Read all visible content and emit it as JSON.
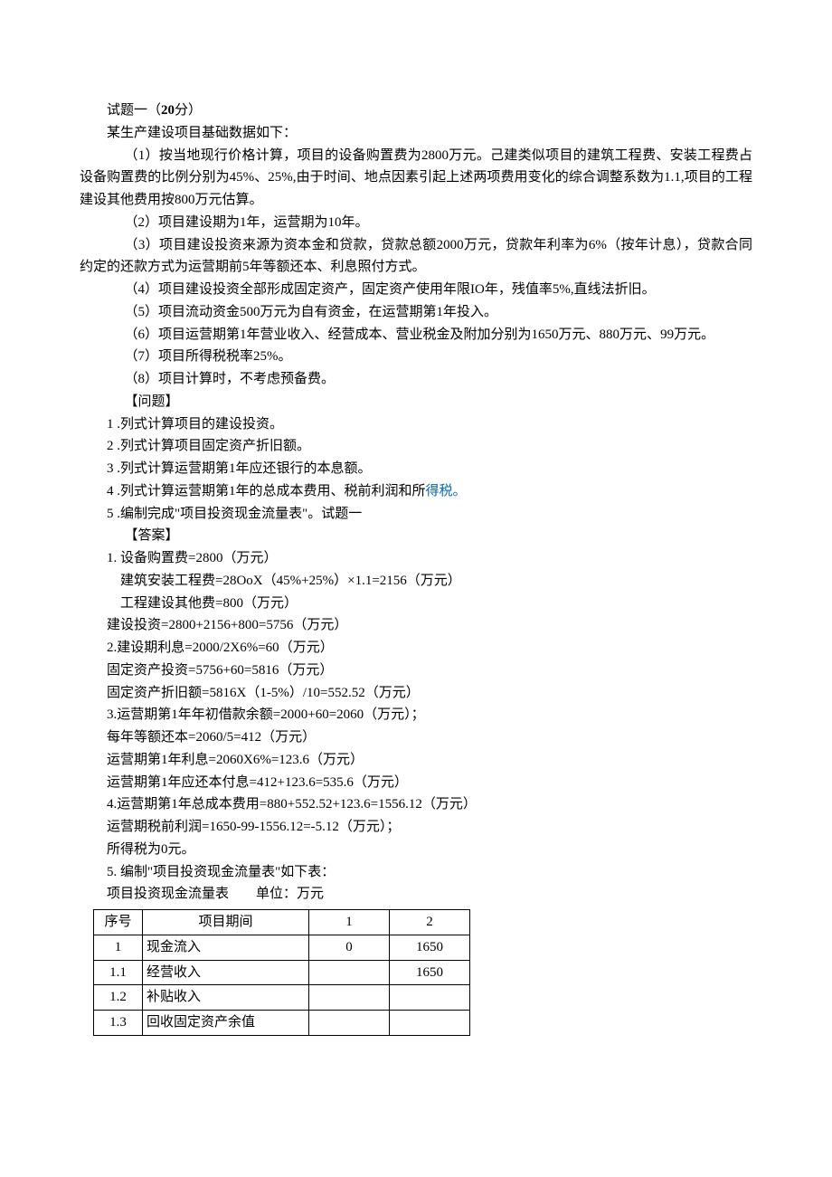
{
  "title_line": {
    "prefix": "试题一（",
    "points": "20",
    "suffix_unit": "分",
    "suffix_paren": "）"
  },
  "intro": "某生产建设项目基础数据如下：",
  "items": [
    {
      "prefix": "（1）按当地现行价格计算，项目的设备购置费为",
      "v1": "2800",
      "mid1": "万元。己建类似项目的建筑工程费、安装工程费占设备购置费的比例分别为",
      "v2": "45%",
      "sep1": "、",
      "v3": "25%",
      "mid2": ",由于时间、地点因素引起上述两项费用变化的综合调整系数为",
      "v4": "1.1",
      "mid3": ",项目的工程建设其他费用按",
      "v5": "800",
      "suffix": "万元估算。"
    },
    {
      "prefix": "（2）项目建设期为",
      "v1": "1",
      "mid1": "年，运营期为",
      "v2": "10",
      "suffix": "年。"
    },
    {
      "prefix": "（3）项目建设投资来源为资本金和贷款，贷款总额",
      "v1": "2000",
      "mid1": "万元，贷款年利率为",
      "v2": "6%",
      "mid2": "（按年计息），贷款合同约定的还款方式为运营期前",
      "v3": "5",
      "suffix": "年等额还本、利息照付方式。"
    },
    {
      "prefix": "（4）项目建设投资全部形成固定资产，固定资产使用年限",
      "v1": "IO",
      "mid1": "年，残值率",
      "v2": "5%",
      "suffix": ",直线法折旧。"
    },
    {
      "prefix": "（5）项目流动资金",
      "v1": "500",
      "mid1": "万元为自有资金，在运营期第",
      "v2": "1",
      "suffix": "年投入。"
    },
    {
      "prefix": "（6）项目运营期第",
      "v1": "1",
      "mid1": "年营业收入、经营成本、营业税金及附加分别为",
      "v2": "1650",
      "mid2": "万元、",
      "v3": "880",
      "mid3": "万元、",
      "v4": "99",
      "suffix": "万元。"
    },
    {
      "prefix": "（7）项目所得税税率",
      "v1": "25%",
      "suffix": "。"
    },
    {
      "prefix": "（8）项目计算时，不考虑预备费。"
    }
  ],
  "question_header": "【问题】",
  "questions": [
    {
      "num": "1",
      "text": " .列式计算项目的建设投资。"
    },
    {
      "num": "2",
      "text": " .列式计算项目固定资产折旧额。"
    },
    {
      "num": "3",
      "text": " .列式计算运营期第",
      "v1": "1",
      "suffix": "年应还银行的本息额。"
    },
    {
      "num": "4",
      "text": " .列式计算运营期第",
      "v1": "1",
      "suffix": "年的总成本费用、税前利润和所",
      "link": "得税。"
    },
    {
      "num": "5",
      "text": " .编制完成\"项目投资现金流量表\"。试题一"
    }
  ],
  "answer_header": "【答案】",
  "answers": {
    "a1": {
      "line1_pre": "1.",
      "line1_txt": " 设备购置费",
      "line1_eq": "=2800",
      "line1_unit": "（万元）",
      "line2_pre": "建筑安装工程费",
      "line2_eq": "=28OoX",
      "line2_p1": "（",
      "line2_v1": "45%+25%",
      "line2_p2": "）",
      "line2_m": "×1.1=2156",
      "line2_unit": "（万元）",
      "line3_pre": "工程建设其他费",
      "line3_eq": "=800",
      "line3_unit": "（万元）",
      "line4_pre": "建设投资",
      "line4_eq": "=2800+2156+800=5756",
      "line4_unit": "（万元）"
    },
    "a2": {
      "line1_pre": "2.",
      "line1_txt": "建设期利息",
      "line1_eq": "=2000/2X6%=60",
      "line1_unit": "（万元）",
      "line2_pre": "固定资产投资",
      "line2_eq": "=5756+60=5816",
      "line2_unit": "（万元）",
      "line3_pre": "固定资产折旧额",
      "line3_eq": "=5816X",
      "line3_p1": "（",
      "line3_v": "1-5%",
      "line3_p2": "）",
      "line3_m": "/10=552.52",
      "line3_unit": "（万元）"
    },
    "a3": {
      "line1_pre": "3.",
      "line1_txt": "运营期第",
      "line1_v": "1",
      "line1_mid": "年年初借款余额",
      "line1_eq": "=2000+60=2060",
      "line1_unit": "（万元）；",
      "line2_pre": "每年等额还本",
      "line2_eq": "=2060/5=412",
      "line2_unit": "（万元）",
      "line3_pre": "运营期第",
      "line3_v": "1",
      "line3_mid": "年利息",
      "line3_eq": "=2060X6%=123.6",
      "line3_unit": "（万元）",
      "line4_pre": "运营期第",
      "line4_v": "1",
      "line4_mid": "年应还本付息",
      "line4_eq": "=412+123.6=535.6",
      "line4_unit": "（万元）"
    },
    "a4": {
      "line1_pre": "4.",
      "line1_txt": "运营期第",
      "line1_v": "1",
      "line1_mid": "年总成本费用",
      "line1_eq": "=880+552.52+123.6=1556.12",
      "line1_unit": "（万元）",
      "line2_pre": "运营期税前利润",
      "line2_eq": "=1650-99-1556.12=-5.12",
      "line2_unit": "（万元）；",
      "line3_pre": "所得税为",
      "line3_v": "0",
      "line3_unit": "元。"
    },
    "a5": {
      "line1_pre": "5.",
      "line1_txt": " 编制\"项目投资现金流量表\"如下表：",
      "caption_pre": "项目投资现金流量表",
      "caption_gap": "　　",
      "caption_unit": "单位：万元"
    }
  },
  "table": {
    "headers": {
      "seq": "序号",
      "item": "项目期间",
      "c1": "1",
      "c2": "2"
    },
    "rows": [
      {
        "seq": "1",
        "item": "现金流入",
        "c1": "0",
        "c2": "1650"
      },
      {
        "seq": "1.1",
        "item": "经营收入",
        "c1": "",
        "c2": "1650"
      },
      {
        "seq": "1.2",
        "item": "补贴收入",
        "c1": "",
        "c2": ""
      },
      {
        "seq": "1.3",
        "item": "回收固定资产余值",
        "c1": "",
        "c2": ""
      }
    ]
  }
}
